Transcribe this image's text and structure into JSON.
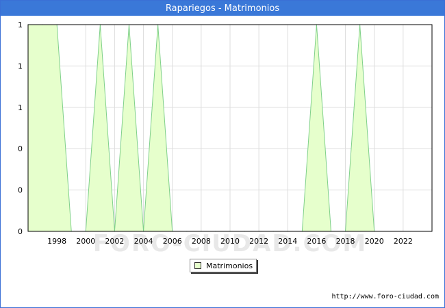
{
  "window": {
    "title": "Rapariegos - Matrimonios",
    "source": "http://www.foro-ciudad.com",
    "watermark": "FORO-CIUDAD.COM"
  },
  "colors": {
    "title_bar": "#3a78d8",
    "area_fill": "#e6ffcc",
    "area_line": "#7fd08a",
    "grid": "#dddddd"
  },
  "chart_data": {
    "type": "area",
    "title": "Rapariegos - Matrimonios",
    "xlabel": "",
    "ylabel": "",
    "xlim": [
      1996,
      2024
    ],
    "ylim": [
      0,
      1
    ],
    "x_ticks": [
      "1998",
      "2000",
      "2002",
      "2004",
      "2006",
      "2008",
      "2010",
      "2012",
      "2014",
      "2016",
      "2018",
      "2020",
      "2022"
    ],
    "y_tick_labels": [
      "0",
      "0",
      "0",
      "1",
      "1",
      "1"
    ],
    "grid": true,
    "legend_position": "bottom-center",
    "series": [
      {
        "name": "Matrimonios",
        "x": [
          1996,
          1997,
          1998,
          1999,
          2000,
          2001,
          2002,
          2003,
          2004,
          2005,
          2006,
          2007,
          2008,
          2009,
          2010,
          2011,
          2012,
          2013,
          2014,
          2015,
          2016,
          2017,
          2018,
          2019,
          2020
        ],
        "values": [
          1,
          1,
          1,
          0,
          0,
          1,
          0,
          1,
          0,
          1,
          0,
          0,
          0,
          0,
          0,
          0,
          0,
          0,
          0,
          0,
          1,
          0,
          0,
          1,
          0
        ]
      }
    ]
  }
}
